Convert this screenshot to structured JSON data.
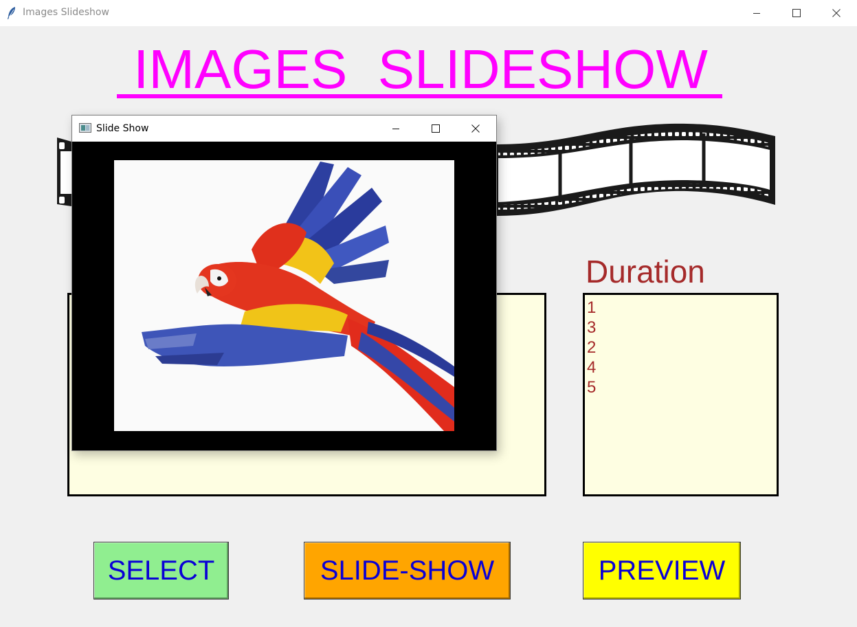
{
  "window": {
    "title": "Images Slideshow",
    "icon": "feather-icon"
  },
  "heading": {
    "text": "IMAGES  SLIDESHOW",
    "color": "#ff00ff"
  },
  "duration": {
    "label": "Duration",
    "items": [
      "1",
      "3",
      "2",
      "4",
      "5"
    ]
  },
  "images_list": {
    "items": []
  },
  "slideshow_window": {
    "title": "Slide Show",
    "icon": "tk-window-icon",
    "image": "parrot-image"
  },
  "buttons": {
    "select": "SELECT",
    "slide_show": "SLIDE-SHOW",
    "preview": "PREVIEW"
  },
  "colors": {
    "select_bg": "#90ee90",
    "slideshow_bg": "#ffa500",
    "preview_bg": "#ffff00",
    "button_text": "#0a00d6",
    "label_text": "#a52a2a",
    "list_bg": "#fefee2"
  }
}
